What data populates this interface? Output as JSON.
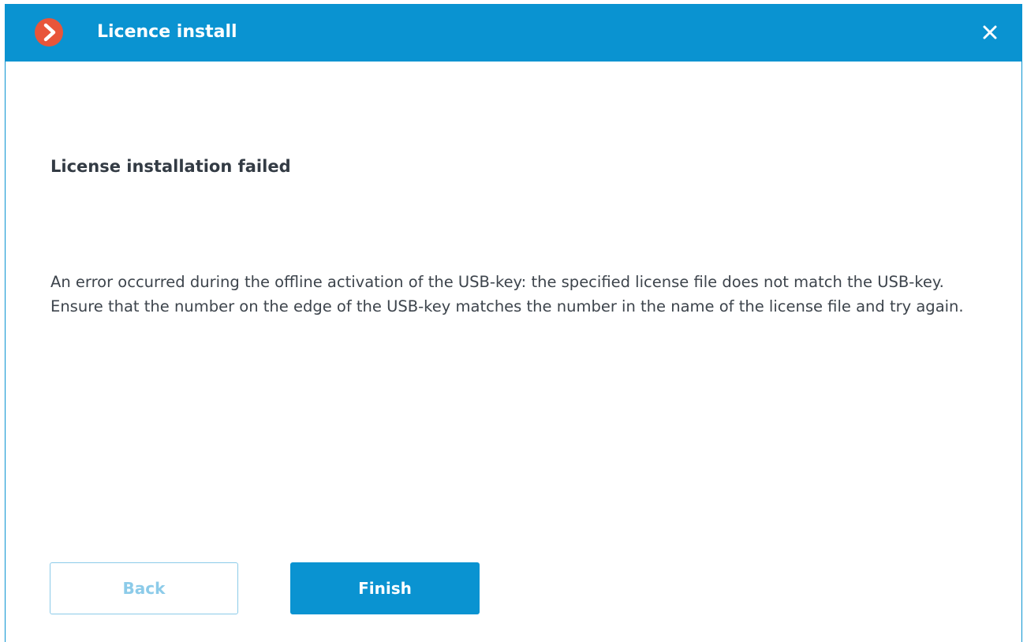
{
  "window": {
    "title": "Licence install",
    "logo_icon": "chevron-right-circle-icon",
    "close_icon": "close-icon",
    "accent_color": "#0a93d1",
    "logo_color": "#e8553a"
  },
  "content": {
    "heading": "License installation failed",
    "message_lines": [
      "An error occurred during the offline activation of the USB-key: the specified license file does not match the USB-key.",
      "Ensure that the number on the edge of the USB-key matches the number in the name of the license file and try again."
    ]
  },
  "buttons": {
    "back_label": "Back",
    "back_enabled": false,
    "finish_label": "Finish"
  }
}
